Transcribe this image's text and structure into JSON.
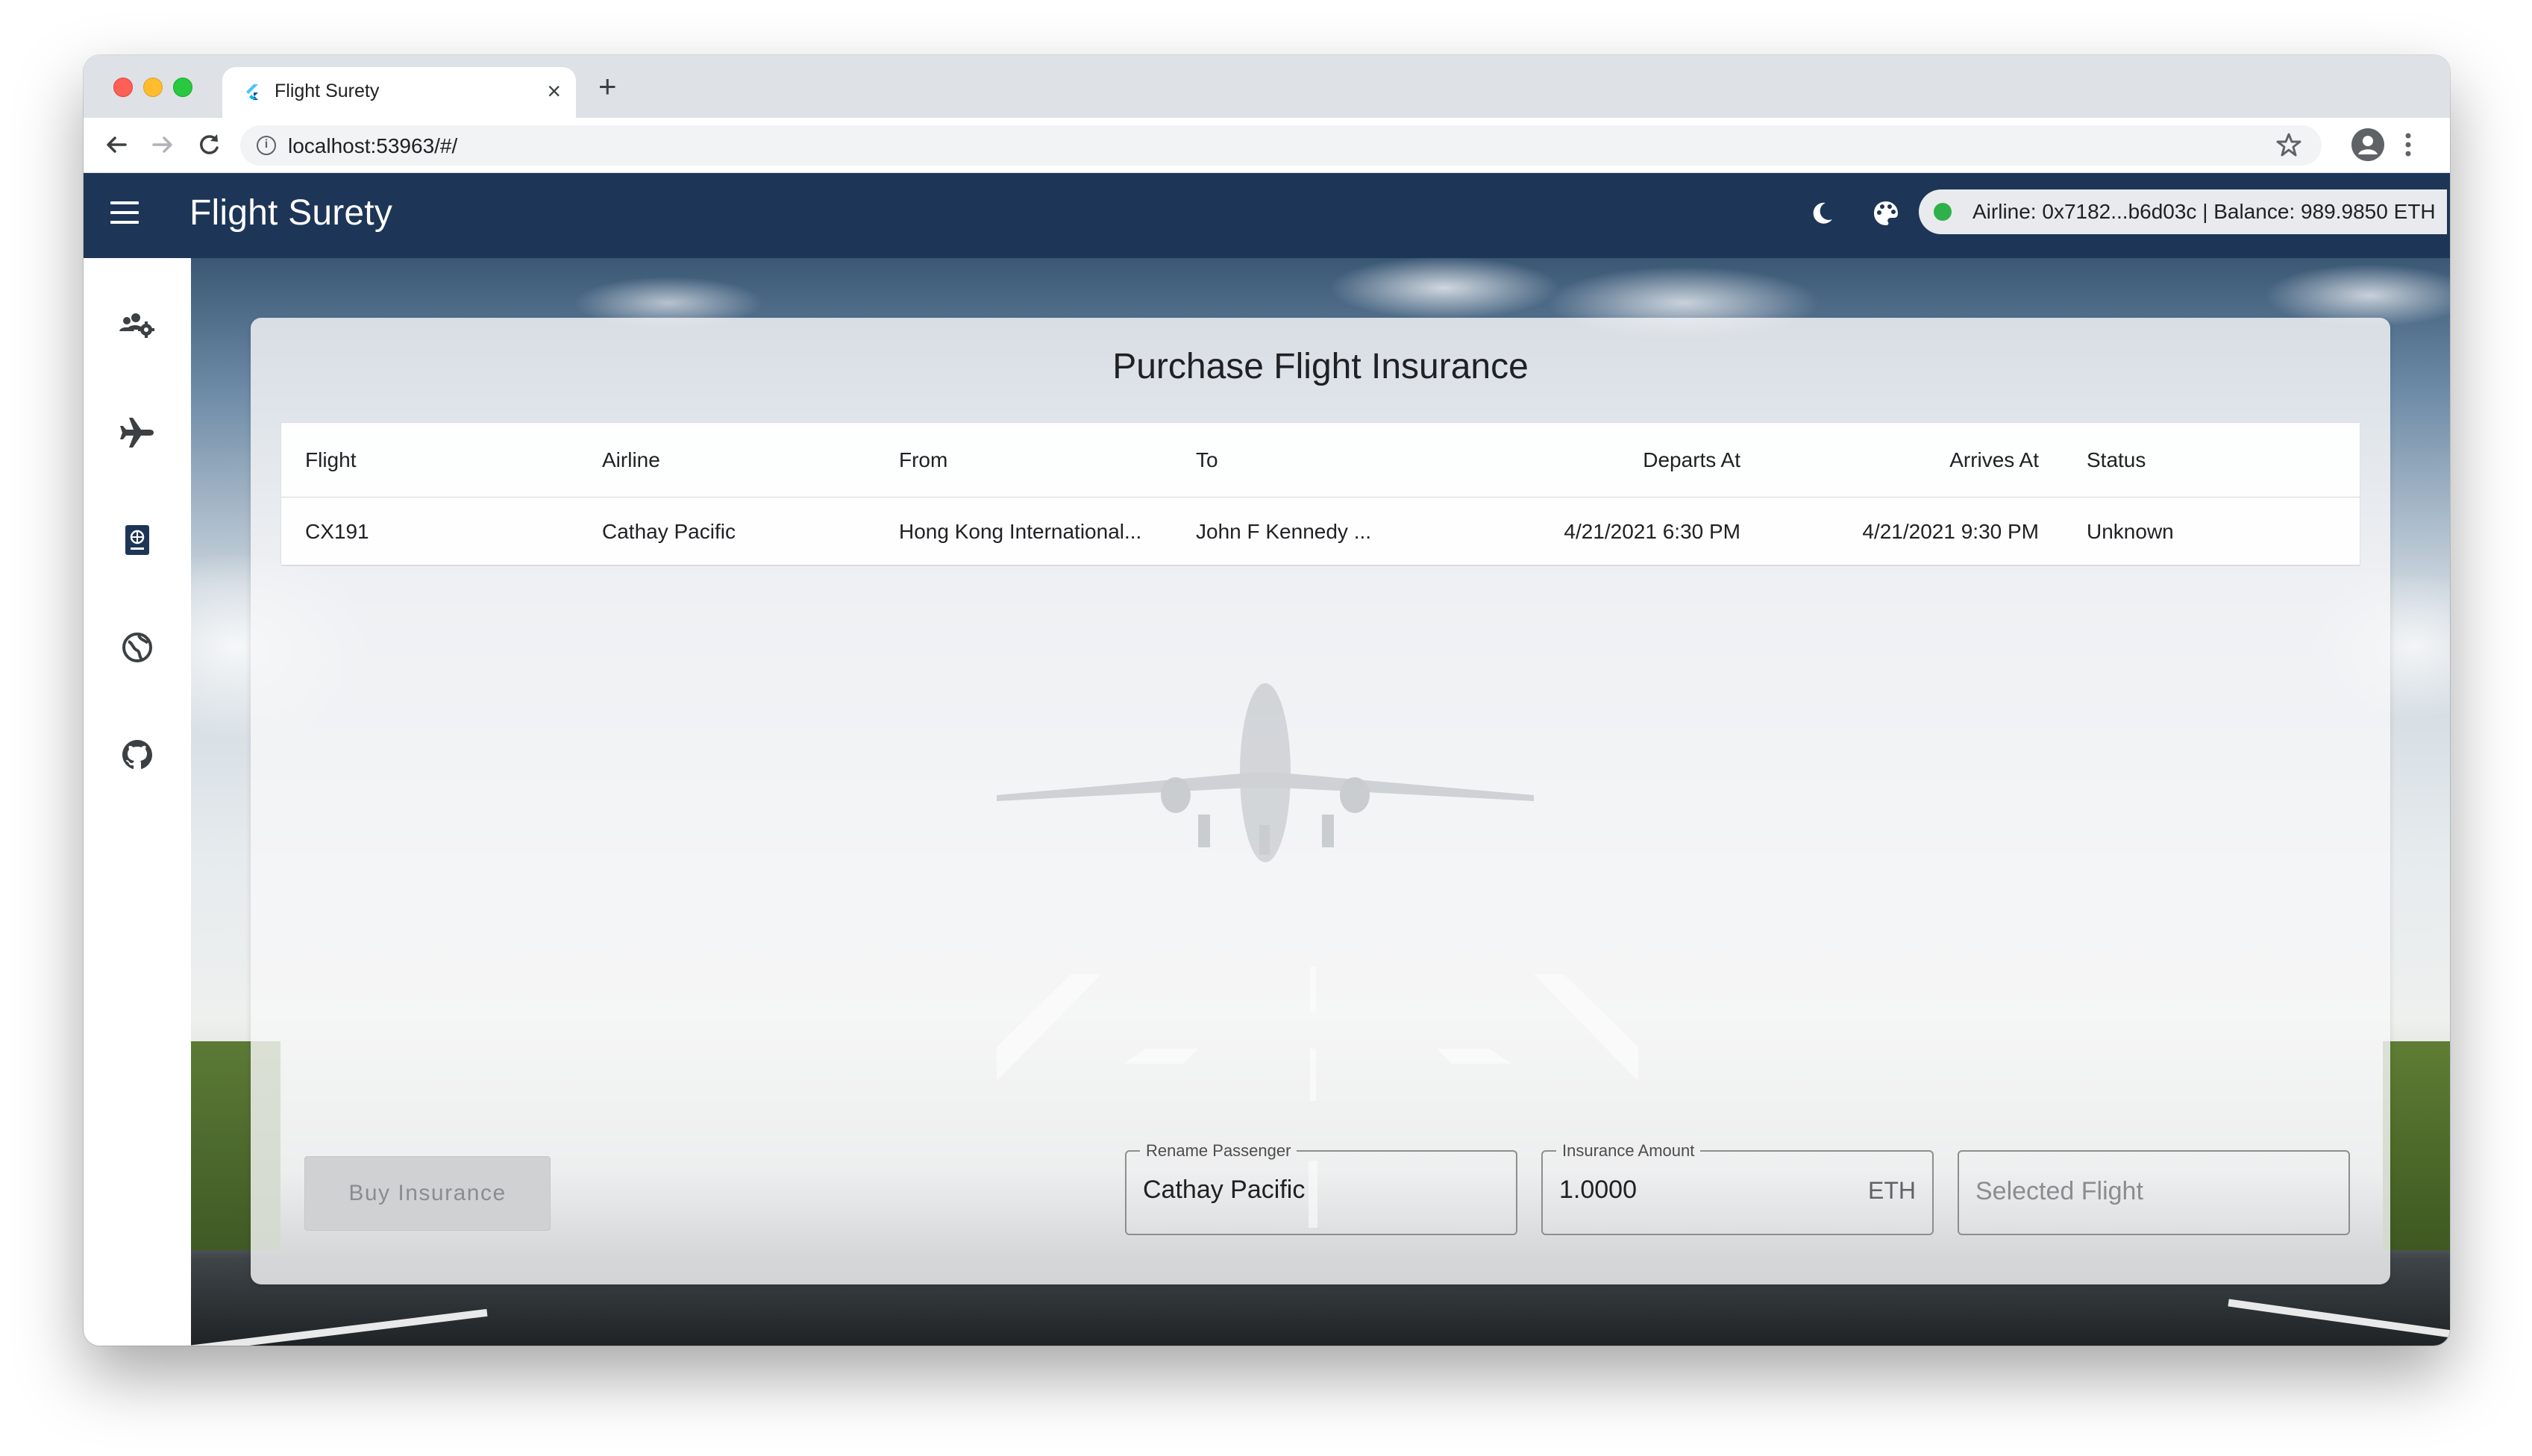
{
  "browser": {
    "tab_title": "Flight Surety",
    "tab_close": "×",
    "new_tab": "+",
    "url": "localhost:53963/#/",
    "info_icon": "i"
  },
  "app": {
    "title": "Flight Surety",
    "account_text": "Airline: 0x7182...b6d03c | Balance: 989.9850 ETH",
    "status_color": "#2fb14a",
    "appbar_color": "#1d3557"
  },
  "sidebar": {
    "items": [
      {
        "icon": "users-settings-icon"
      },
      {
        "icon": "airplane-icon"
      },
      {
        "icon": "passport-icon"
      },
      {
        "icon": "globe-icon"
      },
      {
        "icon": "github-icon"
      }
    ]
  },
  "main": {
    "title": "Purchase Flight Insurance",
    "table": {
      "headers": [
        "Flight",
        "Airline",
        "From",
        "To",
        "Departs At",
        "Arrives At",
        "Status"
      ],
      "rows": [
        [
          "CX191",
          "Cathay Pacific",
          "Hong Kong International...",
          "John F Kennedy ...",
          "4/21/2021 6:30 PM",
          "4/21/2021 9:30 PM",
          "Unknown"
        ]
      ]
    },
    "buy_button": "Buy Insurance",
    "fields": {
      "passenger": {
        "label": "Rename Passenger",
        "value": "Cathay Pacific"
      },
      "amount": {
        "label": "Insurance Amount",
        "value": "1.0000",
        "suffix": "ETH"
      },
      "selected": {
        "placeholder": "Selected Flight"
      }
    }
  }
}
